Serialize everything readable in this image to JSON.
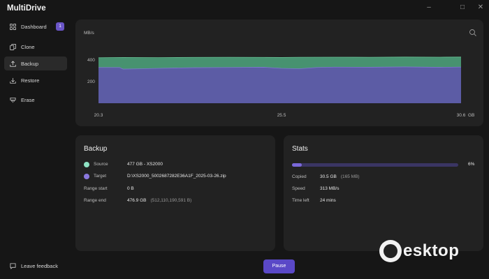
{
  "app": {
    "title": "MultiDrive"
  },
  "window_controls": {
    "minimize": "–",
    "maximize": "□",
    "close": "✕"
  },
  "sidebar": {
    "items": [
      {
        "label": "Dashboard",
        "icon": "grid-icon",
        "badge": "1",
        "active": false
      },
      {
        "label": "Clone",
        "icon": "clone-icon",
        "active": false
      },
      {
        "label": "Backup",
        "icon": "backup-icon",
        "active": true
      },
      {
        "label": "Restore",
        "icon": "restore-icon",
        "active": false
      },
      {
        "label": "Erase",
        "icon": "erase-icon",
        "active": false
      }
    ],
    "feedback_label": "Leave feedback"
  },
  "chart": {
    "unit_label": "MB/s",
    "y_ticks": [
      "400",
      "200"
    ],
    "x_ticks": [
      "20.3",
      "25.5",
      "30.6"
    ],
    "x_unit": "GB"
  },
  "chart_data": {
    "type": "area",
    "ylabel": "MB/s",
    "xlabel": "GB",
    "x_ticks": [
      "20.3",
      "25.5",
      "30.6"
    ],
    "y_ticks": [
      "200",
      "400"
    ],
    "ylim": [
      0,
      560
    ],
    "xlim": [
      20.3,
      30.6
    ],
    "series": [
      {
        "color": "#4ea67e",
        "x": [
          20.3,
          21.0,
          22.0,
          23.0,
          24.0,
          25.0,
          25.5,
          26.0,
          27.0,
          28.0,
          29.0,
          30.0,
          30.6
        ],
        "values": [
          420,
          422,
          421,
          423,
          424,
          423,
          422,
          424,
          425,
          424,
          426,
          425,
          426
        ]
      },
      {
        "color": "#5e5aa8",
        "x": [
          20.3,
          20.9,
          21.0,
          21.5,
          22.0,
          23.0,
          24.0,
          25.0,
          25.5,
          26.0,
          26.5,
          27.0,
          28.0,
          29.0,
          30.0,
          30.6
        ],
        "values": [
          330,
          330,
          315,
          318,
          322,
          328,
          330,
          332,
          322,
          318,
          330,
          333,
          332,
          335,
          331,
          334
        ]
      }
    ]
  },
  "backup": {
    "title": "Backup",
    "source_label": "Source",
    "source_value": "477 GB - XS2000",
    "source_color": "#8fe3c4",
    "target_label": "Target",
    "target_value": "D:\\XS2000_5002687282E36A1F_2025-03-26.zip",
    "target_color": "#8a78de",
    "range_start_label": "Range start",
    "range_start_value": "0 B",
    "range_end_label": "Range end",
    "range_end_value": "476.9 GB",
    "range_end_bytes": "(512,110,190,591 B)"
  },
  "stats": {
    "title": "Stats",
    "progress_percent": 6,
    "progress_text": "6%",
    "copied_label": "Copied",
    "copied_value": "30.5 GB",
    "copied_sub": "(165 MB)",
    "speed_label": "Speed",
    "speed_value": "313 MB/s",
    "time_left_label": "Time left",
    "time_left_value": "24 mins"
  },
  "actions": {
    "pause_label": "Pause"
  },
  "watermark": {
    "text": "esktop"
  }
}
